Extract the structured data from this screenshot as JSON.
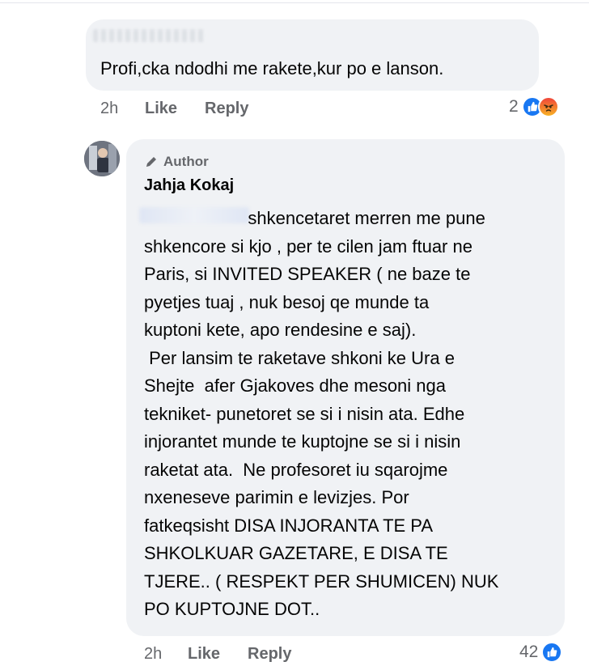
{
  "comment1": {
    "text": "Profi,cka ndodhi me rakete,kur po e lanson.",
    "time": "2h",
    "like_label": "Like",
    "reply_label": "Reply",
    "reaction_count": "2"
  },
  "comment2": {
    "author_badge": "Author",
    "author_name": "Jahja Kokaj",
    "lines": [
      "                     shkencetaret merren me pune",
      "shkencore si kjo , per te cilen jam ftuar ne",
      "Paris, si INVITED SPEAKER ( ne baze te",
      "pyetjes tuaj , nuk besoj qe munde ta",
      "kuptoni kete, apo rendesine e saj).",
      " Per lansim te raketave shkoni ke Ura e",
      "Shejte  afer Gjakoves dhe mesoni nga",
      "tekniket- punetoret se si i nisin ata. Edhe",
      "injorantet munde te kuptojne se si i nisin",
      "raketat ata.  Ne profesoret iu sqarojme",
      "nxeneseve parimin e levizjes. Por",
      "fatkeqsisht DISA INJORANTA TE PA",
      "SHKOLKUAR GAZETARE, E DISA TE",
      "TJERE.. ( RESPEKT PER SHUMICEN) NUK",
      "PO KUPTOJNE DOT.."
    ],
    "time": "2h",
    "like_label": "Like",
    "reply_label": "Reply",
    "reaction_count": "42"
  },
  "icons": {
    "like": "like-reaction-icon",
    "angry": "angry-reaction-icon",
    "author": "pencil-icon"
  },
  "colors": {
    "bubble": "#f0f2f5",
    "secondary_text": "#65676b",
    "like_blue": "#1877f2"
  }
}
